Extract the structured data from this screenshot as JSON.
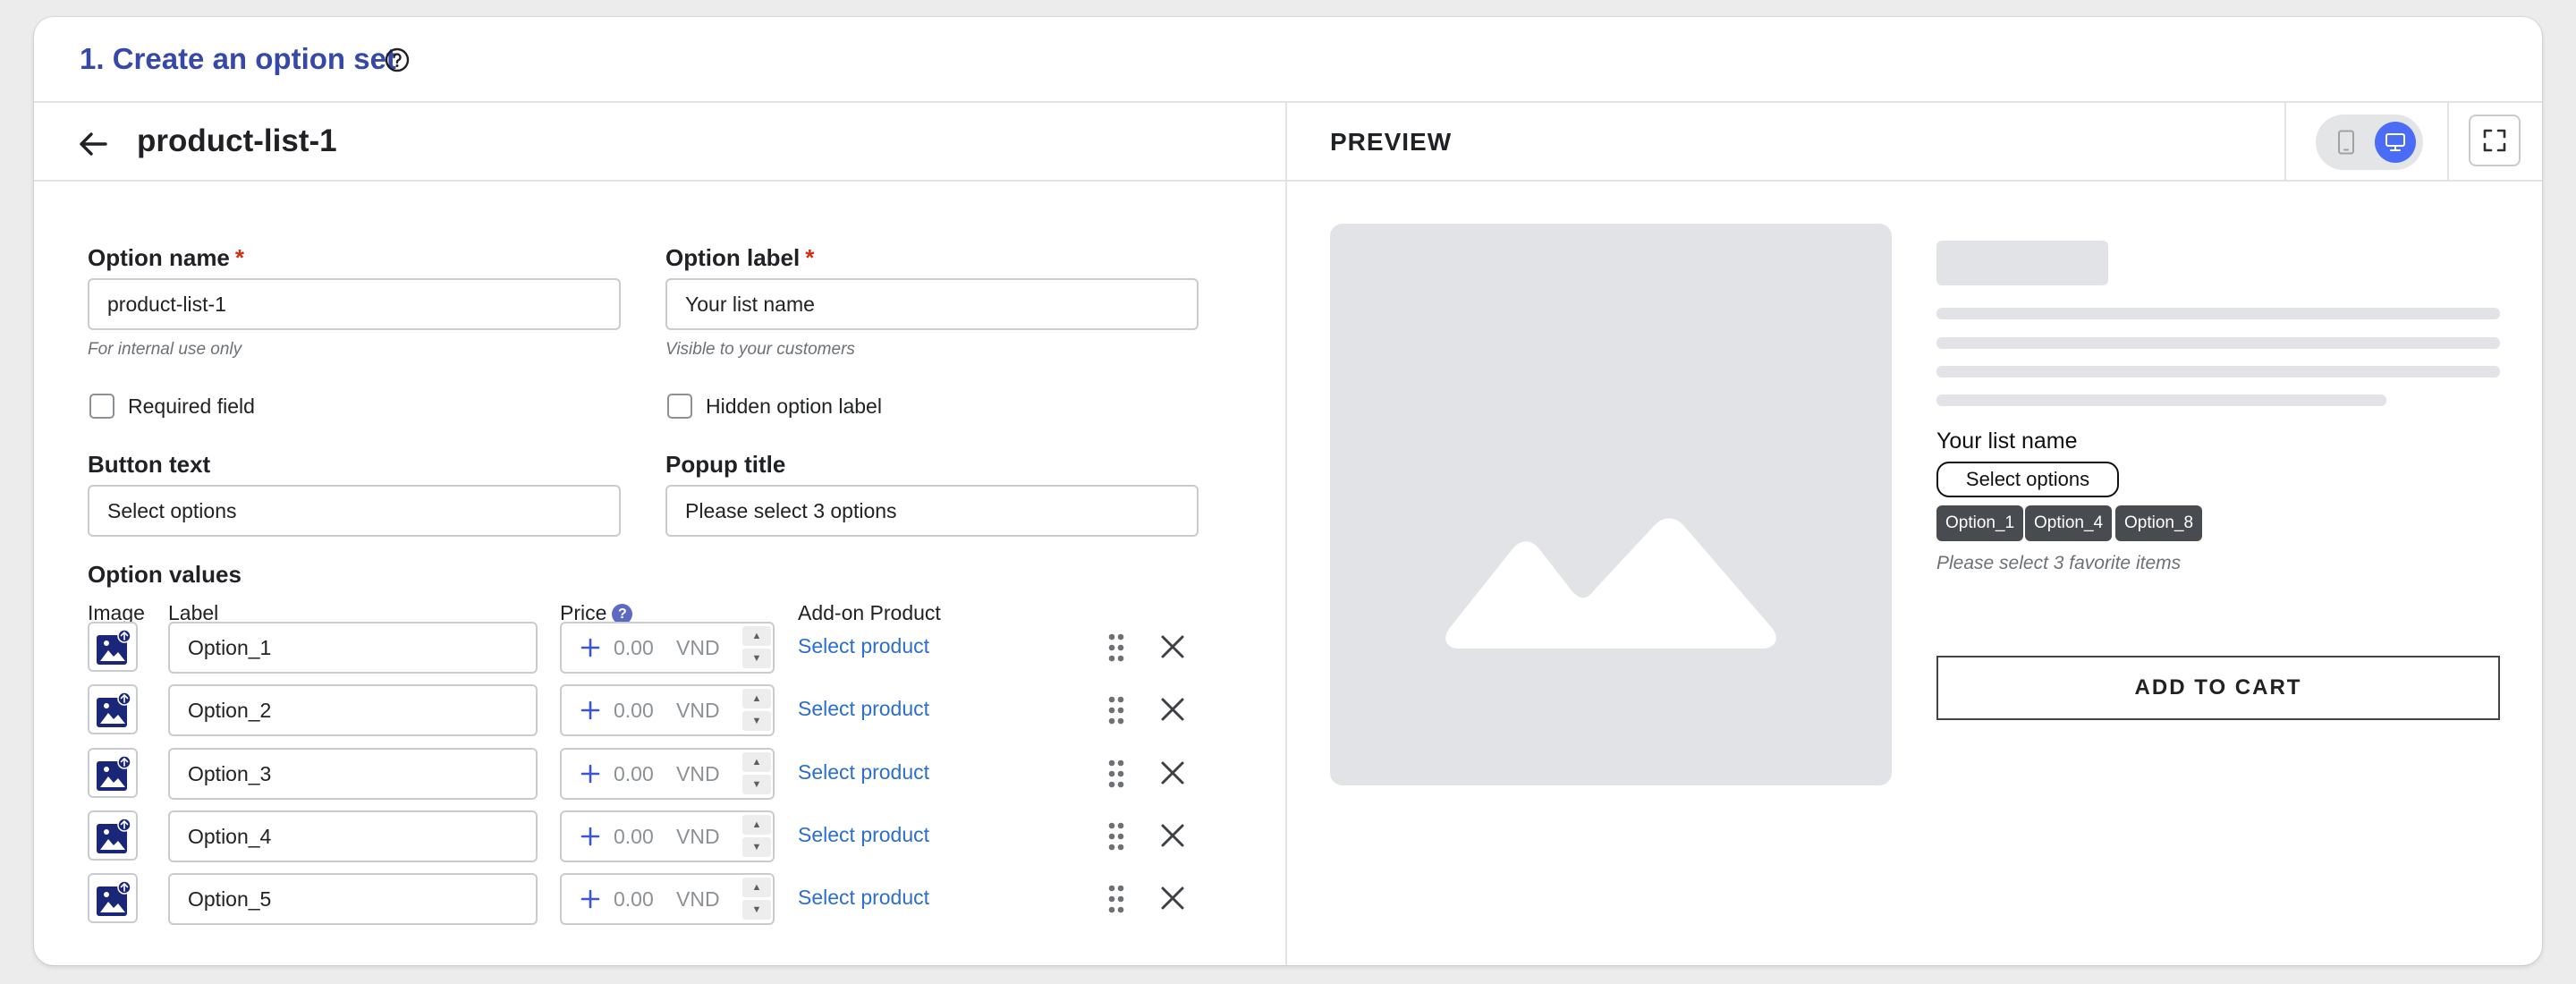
{
  "page": {
    "title": "1. Create an option set",
    "help_icon": "question-circle-icon"
  },
  "editor": {
    "set_name": "product-list-1",
    "back_icon": "arrow-left-icon",
    "option_name_label": "Option name",
    "required_mark": "*",
    "option_name_value": "product-list-1",
    "option_name_hint": "For internal use only",
    "option_label_label": "Option label",
    "option_label_value": "Your list name",
    "option_label_hint": "Visible to your customers",
    "required_field_label": "Required field",
    "hidden_label_label": "Hidden option label",
    "button_text_label": "Button text",
    "button_text_value": "Select options",
    "popup_title_label": "Popup title",
    "popup_title_value": "Please select 3 options",
    "option_values_label": "Option values",
    "columns": {
      "image": "Image",
      "label": "Label",
      "price": "Price",
      "price_info": "?",
      "addon": "Add-on Product"
    },
    "rows": [
      {
        "label": "Option_1",
        "price": "0.00",
        "currency": "VND",
        "addon": "Select product"
      },
      {
        "label": "Option_2",
        "price": "0.00",
        "currency": "VND",
        "addon": "Select product"
      },
      {
        "label": "Option_3",
        "price": "0.00",
        "currency": "VND",
        "addon": "Select product"
      },
      {
        "label": "Option_4",
        "price": "0.00",
        "currency": "VND",
        "addon": "Select product"
      },
      {
        "label": "Option_5",
        "price": "0.00",
        "currency": "VND",
        "addon": "Select product"
      }
    ],
    "spin_up": "▲",
    "spin_down": "▼"
  },
  "preview": {
    "title": "PREVIEW",
    "device_selected": "desktop",
    "accent_color": "#4a6cf7",
    "list_name": "Your list name",
    "select_button": "Select options",
    "chips": [
      "Option_1",
      "Option_4",
      "Option_8"
    ],
    "hint": "Please select 3 favorite items",
    "add_to_cart": "ADD TO CART"
  }
}
